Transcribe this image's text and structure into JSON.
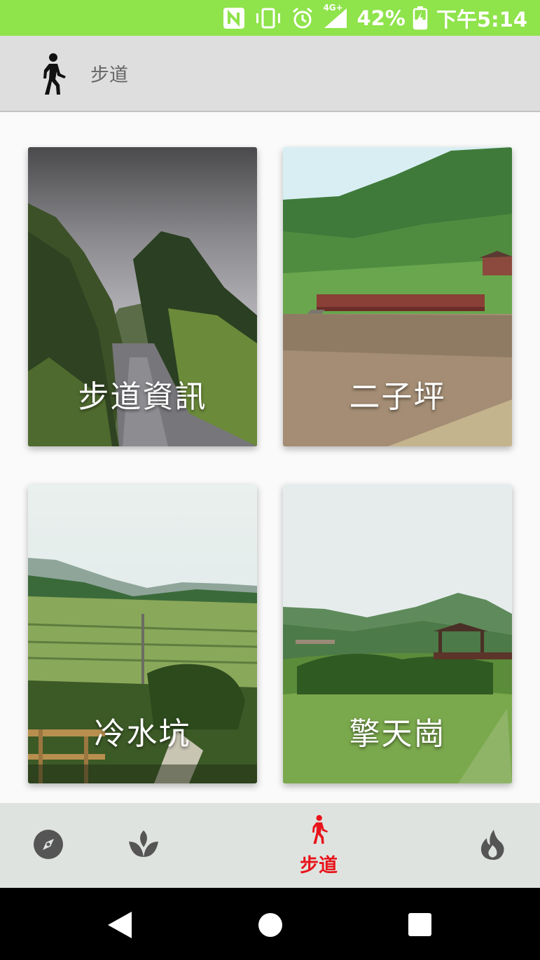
{
  "status_bar": {
    "network": "4G+",
    "battery": "42%",
    "time": "下午5:14",
    "icons": [
      "nfc-icon",
      "vibrate-icon",
      "alarm-icon",
      "signal-icon",
      "battery-charging-icon"
    ]
  },
  "app_bar": {
    "title": "步道",
    "icon": "walking-person-icon"
  },
  "cards": [
    {
      "label": "步道資訊"
    },
    {
      "label": "二子坪"
    },
    {
      "label": "冷水坑"
    },
    {
      "label": "擎天崗"
    }
  ],
  "bottom_nav": {
    "items": [
      {
        "icon": "compass-icon"
      },
      {
        "icon": "sprout-icon"
      },
      {
        "icon": "walking-person-icon",
        "label": "步道",
        "active": true
      },
      {
        "icon": "flame-icon"
      }
    ],
    "active_color": "#e8141b"
  },
  "colors": {
    "status_bar": "#8fe34b",
    "app_bar": "#dedede",
    "bottom_nav": "#dfe3df"
  }
}
